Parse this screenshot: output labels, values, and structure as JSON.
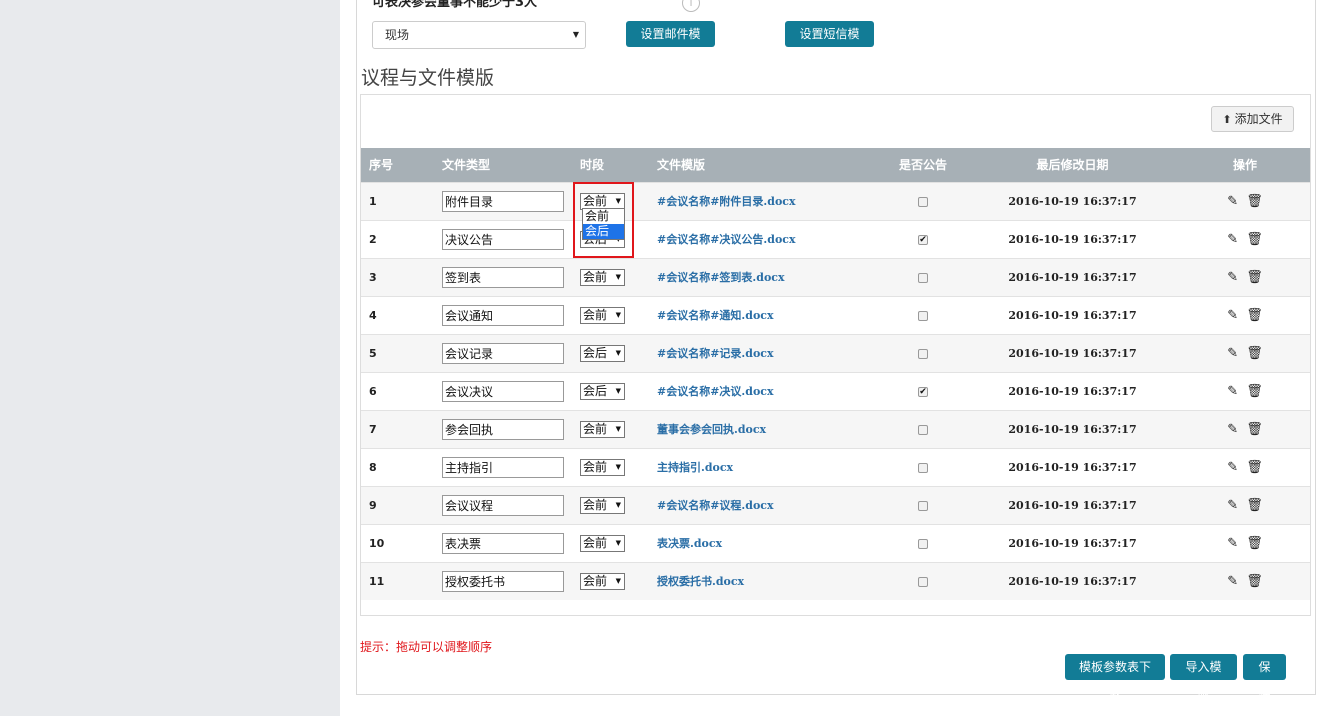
{
  "top": {
    "label": "可表决参会董事不能少于3人",
    "info_icon": "i",
    "venue_select": "现场",
    "email_button": "设置邮件模版",
    "sms_button": "设置短信模版"
  },
  "section": {
    "title": "议程与文件模版",
    "add_button": "添加文件"
  },
  "table": {
    "headers": [
      "序号",
      "文件类型",
      "时段",
      "文件模版",
      "是否公告",
      "最后修改日期",
      "操作"
    ],
    "rows": [
      {
        "no": "1",
        "type": "附件目录",
        "segment": "会前",
        "template": "#会议名称#附件目录.docx",
        "public": false,
        "date": "2016-10-19 16:37:17"
      },
      {
        "no": "2",
        "type": "决议公告",
        "segment": "会后",
        "template": "#会议名称#决议公告.docx",
        "public": true,
        "date": "2016-10-19 16:37:17"
      },
      {
        "no": "3",
        "type": "签到表",
        "segment": "会前",
        "template": "#会议名称#签到表.docx",
        "public": false,
        "date": "2016-10-19 16:37:17"
      },
      {
        "no": "4",
        "type": "会议通知",
        "segment": "会前",
        "template": "#会议名称#通知.docx",
        "public": false,
        "date": "2016-10-19 16:37:17"
      },
      {
        "no": "5",
        "type": "会议记录",
        "segment": "会后",
        "template": "#会议名称#记录.docx",
        "public": false,
        "date": "2016-10-19 16:37:17"
      },
      {
        "no": "6",
        "type": "会议决议",
        "segment": "会后",
        "template": "#会议名称#决议.docx",
        "public": true,
        "date": "2016-10-19 16:37:17"
      },
      {
        "no": "7",
        "type": "参会回执",
        "segment": "会前",
        "template": "董事会参会回执.docx",
        "public": false,
        "date": "2016-10-19 16:37:17"
      },
      {
        "no": "8",
        "type": "主持指引",
        "segment": "会前",
        "template": "主持指引.docx",
        "public": false,
        "date": "2016-10-19 16:37:17"
      },
      {
        "no": "9",
        "type": "会议议程",
        "segment": "会前",
        "template": "#会议名称#议程.docx",
        "public": false,
        "date": "2016-10-19 16:37:17"
      },
      {
        "no": "10",
        "type": "表决票",
        "segment": "会前",
        "template": "表决票.docx",
        "public": false,
        "date": "2016-10-19 16:37:17"
      },
      {
        "no": "11",
        "type": "授权委托书",
        "segment": "会前",
        "template": "授权委托书.docx",
        "public": false,
        "date": "2016-10-19 16:37:17"
      }
    ]
  },
  "dropdown": {
    "options": [
      "会前",
      "会后"
    ],
    "highlighted": "会后"
  },
  "icons": {
    "edit": "edit-icon",
    "delete": "trash-icon",
    "upload": "upload-icon",
    "check_mark": "✔"
  },
  "footer": {
    "tip": "提示：拖动可以调整顺序",
    "download_params_button": "模板参数表下载",
    "import_button": "导入模版",
    "save_button": "保存"
  },
  "colors": {
    "accent": "#127c96",
    "header_bg": "#a7b0b6",
    "tip": "#e0161b",
    "link": "#2a6ea6"
  }
}
